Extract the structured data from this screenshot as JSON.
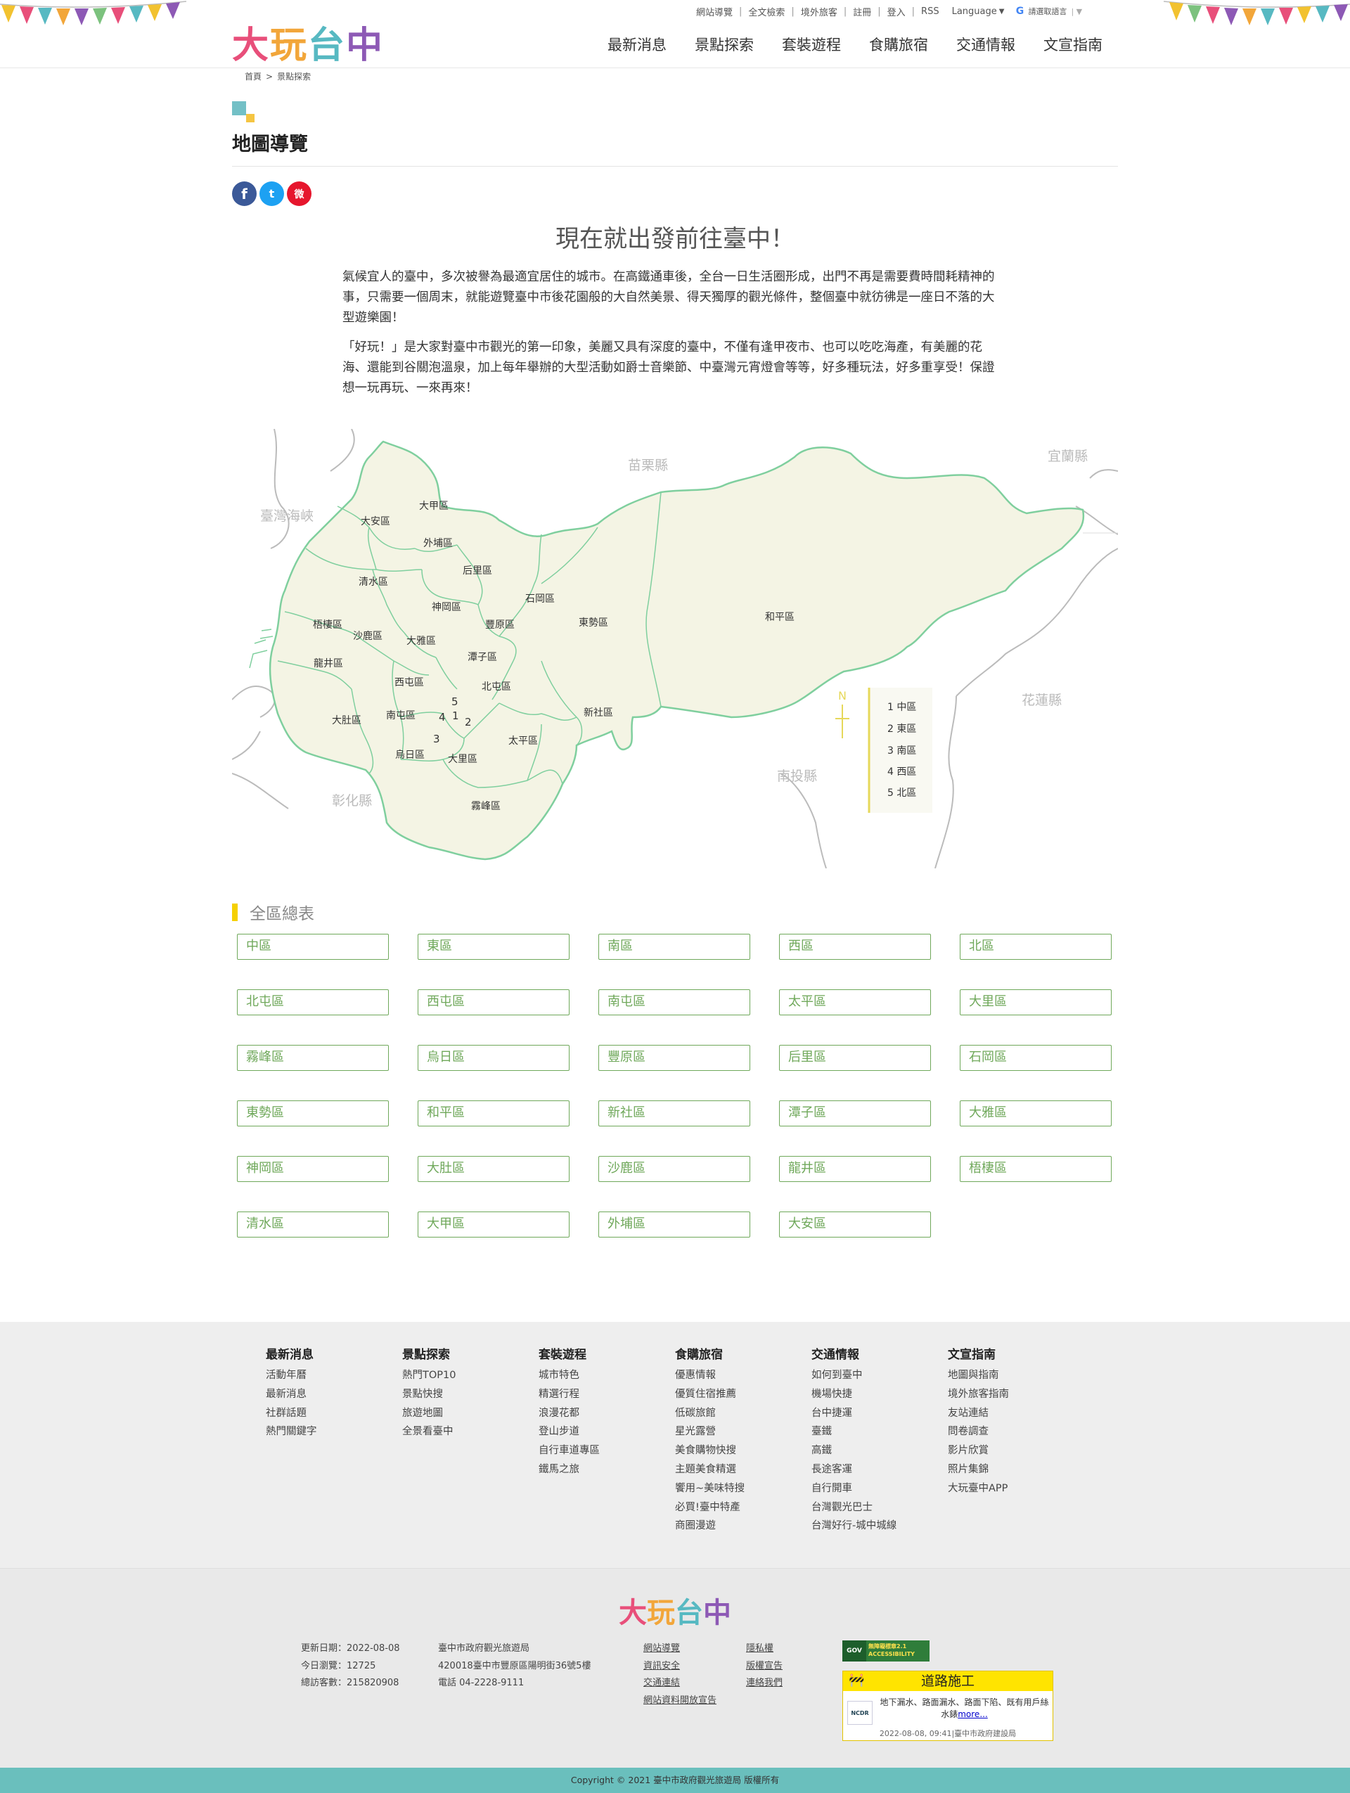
{
  "header": {
    "logo_text": [
      "大",
      "玩",
      "台",
      "中"
    ],
    "logo_colors": [
      "#e84f7a",
      "#f2a63a",
      "#57b9c2",
      "#8d59b5"
    ],
    "top_links": [
      "網站導覽",
      "全文檢索",
      "境外旅客",
      "註冊",
      "登入",
      "RSS"
    ],
    "language_label": "Language",
    "translate_label": "請選取語言",
    "nav": [
      "最新消息",
      "景點探索",
      "套裝遊程",
      "食購旅宿",
      "交通情報",
      "文宣指南"
    ]
  },
  "breadcrumb": [
    "首頁",
    "景點探索"
  ],
  "page_title": "地圖導覽",
  "share": {
    "facebook": "f",
    "twitter": "t",
    "weibo": "微"
  },
  "intro": {
    "title": "現在就出發前往臺中！",
    "p1": "氣候宜人的臺中，多次被譽為最適宜居住的城市。在高鐵通車後，全台一日生活圈形成，出門不再是需要費時間耗精神的事，只需要一個周末，就能遊覽臺中市後花園般的大自然美景、得天獨厚的觀光條件，整個臺中就彷彿是一座日不落的大型遊樂園！",
    "p2": "「好玩！」是大家對臺中市觀光的第一印象，美麗又具有深度的臺中，不僅有逢甲夜市、也可以吃吃海產，有美麗的花海、還能到谷關泡溫泉，加上每年舉辦的大型活動如爵士音樂節、中臺灣元宵燈會等等，好多種玩法，好多重享受！保證想一玩再玩、一來再來！"
  },
  "map": {
    "neighbors": [
      "苗栗縣",
      "宜蘭縣",
      "臺灣海峽",
      "花蓮縣",
      "南投縣",
      "彰化縣"
    ],
    "districts": [
      "大甲區",
      "大安區",
      "外埔區",
      "后里區",
      "清水區",
      "神岡區",
      "石岡區",
      "梧棲區",
      "沙鹿區",
      "豐原區",
      "東勢區",
      "和平區",
      "大雅區",
      "潭子區",
      "龍井區",
      "西屯區",
      "北屯區",
      "新社區",
      "大肚區",
      "南屯區",
      "太平區",
      "烏日區",
      "大里區",
      "霧峰區"
    ],
    "numbers": [
      "1",
      "2",
      "3",
      "4",
      "5"
    ],
    "north_label": "N",
    "legend": [
      "1 中區",
      "2 東區",
      "3 南區",
      "4 西區",
      "5 北區"
    ]
  },
  "district_list": {
    "title": "全區總表",
    "items": [
      "中區",
      "東區",
      "南區",
      "西區",
      "北區",
      "北屯區",
      "西屯區",
      "南屯區",
      "太平區",
      "大里區",
      "霧峰區",
      "烏日區",
      "豐原區",
      "后里區",
      "石岡區",
      "東勢區",
      "和平區",
      "新社區",
      "潭子區",
      "大雅區",
      "神岡區",
      "大肚區",
      "沙鹿區",
      "龍井區",
      "梧棲區",
      "清水區",
      "大甲區",
      "外埔區",
      "大安區"
    ]
  },
  "footer": {
    "columns": [
      {
        "title": "最新消息",
        "links": [
          "活動年曆",
          "最新消息",
          "社群話題",
          "熱門關鍵字"
        ]
      },
      {
        "title": "景點探索",
        "links": [
          "熱門TOP10",
          "景點快搜",
          "旅遊地圖",
          "全景看臺中"
        ]
      },
      {
        "title": "套裝遊程",
        "links": [
          "城市特色",
          "精選行程",
          "浪漫花都",
          "登山步道",
          "自行車道專區",
          "鐵馬之旅"
        ]
      },
      {
        "title": "食購旅宿",
        "links": [
          "優惠情報",
          "優質住宿推薦",
          "低碳旅館",
          "星光露營",
          "美食購物快搜",
          "主題美食精選",
          "饗用~美味特搜",
          "必買!臺中特產",
          "商圈漫遊"
        ]
      },
      {
        "title": "交通情報",
        "links": [
          "如何到臺中",
          "機場快捷",
          "台中捷運",
          "臺鐵",
          "高鐵",
          "長途客運",
          "自行開車",
          "台灣觀光巴士",
          "台灣好行-城中城線"
        ]
      },
      {
        "title": "文宣指南",
        "links": [
          "地圖與指南",
          "境外旅客指南",
          "友站連結",
          "問卷調查",
          "影片欣賞",
          "照片集錦",
          "大玩臺中APP"
        ]
      }
    ],
    "logo_text": [
      "大",
      "玩",
      "台",
      "中"
    ],
    "stats": [
      "更新日期：2022-08-08",
      "今日瀏覽：12725",
      "總訪客數：215820908"
    ],
    "org": [
      "臺中市政府觀光旅遊局",
      "420018臺中市豐原區陽明街36號5樓",
      "電話 04-2228-9111"
    ],
    "links_a": [
      "網站導覽",
      "資訊安全",
      "交通連結",
      "網站資料開放宣告"
    ],
    "links_b": [
      "隱私權",
      "版權宣告",
      "連絡我們"
    ],
    "accessibility_badge": [
      "GOV",
      "無障礙標章2.1",
      "ACCESSIBILITY"
    ],
    "road_work": {
      "title": "道路施工",
      "logo": "NCDR",
      "text": "地下漏水、路面漏水、路面下陷、既有用戶絲水錶",
      "more": "more...",
      "meta": "2022-08-08, 09:41|臺中市政府建設局"
    },
    "copyright": "Copyright © 2021 臺中市政府觀光旅遊局 版權所有"
  }
}
